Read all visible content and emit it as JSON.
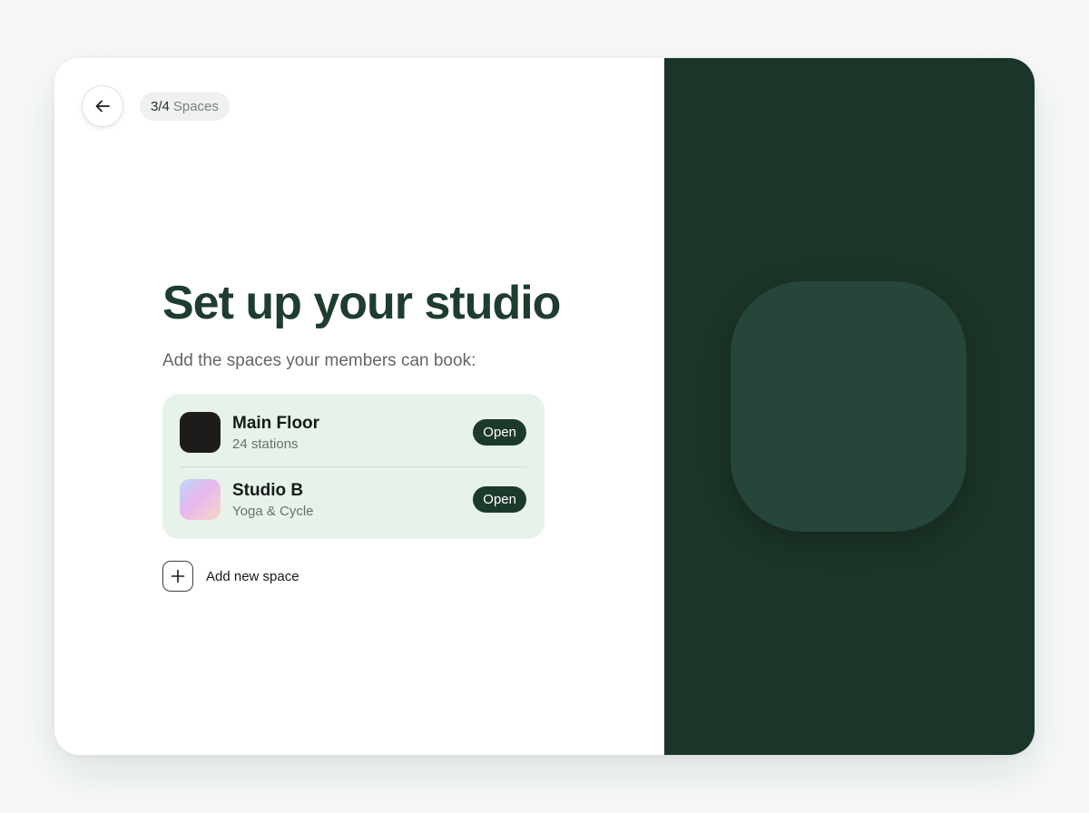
{
  "nav": {
    "back_icon": "arrow-left-icon",
    "step_current": "3",
    "step_separator": "/",
    "step_total": "4",
    "step_label": "Spaces"
  },
  "heading": {
    "title": "Set up your studio",
    "subtitle": "Add the spaces your members can book:"
  },
  "spaces": [
    {
      "name": "Main Floor",
      "meta": "24 stations",
      "action": "Open",
      "icon_color": "#1e1c1a"
    },
    {
      "name": "Studio B",
      "meta": "Yoga & Cycle",
      "action": "Open",
      "icon_style": "pastel-gradient"
    }
  ],
  "add_space": {
    "label": "Add new space",
    "icon": "plus-icon"
  },
  "colors": {
    "accent": "#1f3d2f",
    "panel_dark": "#1c3529",
    "list_bg": "#e7f3ea",
    "button_dark": "#1c3a2c"
  }
}
